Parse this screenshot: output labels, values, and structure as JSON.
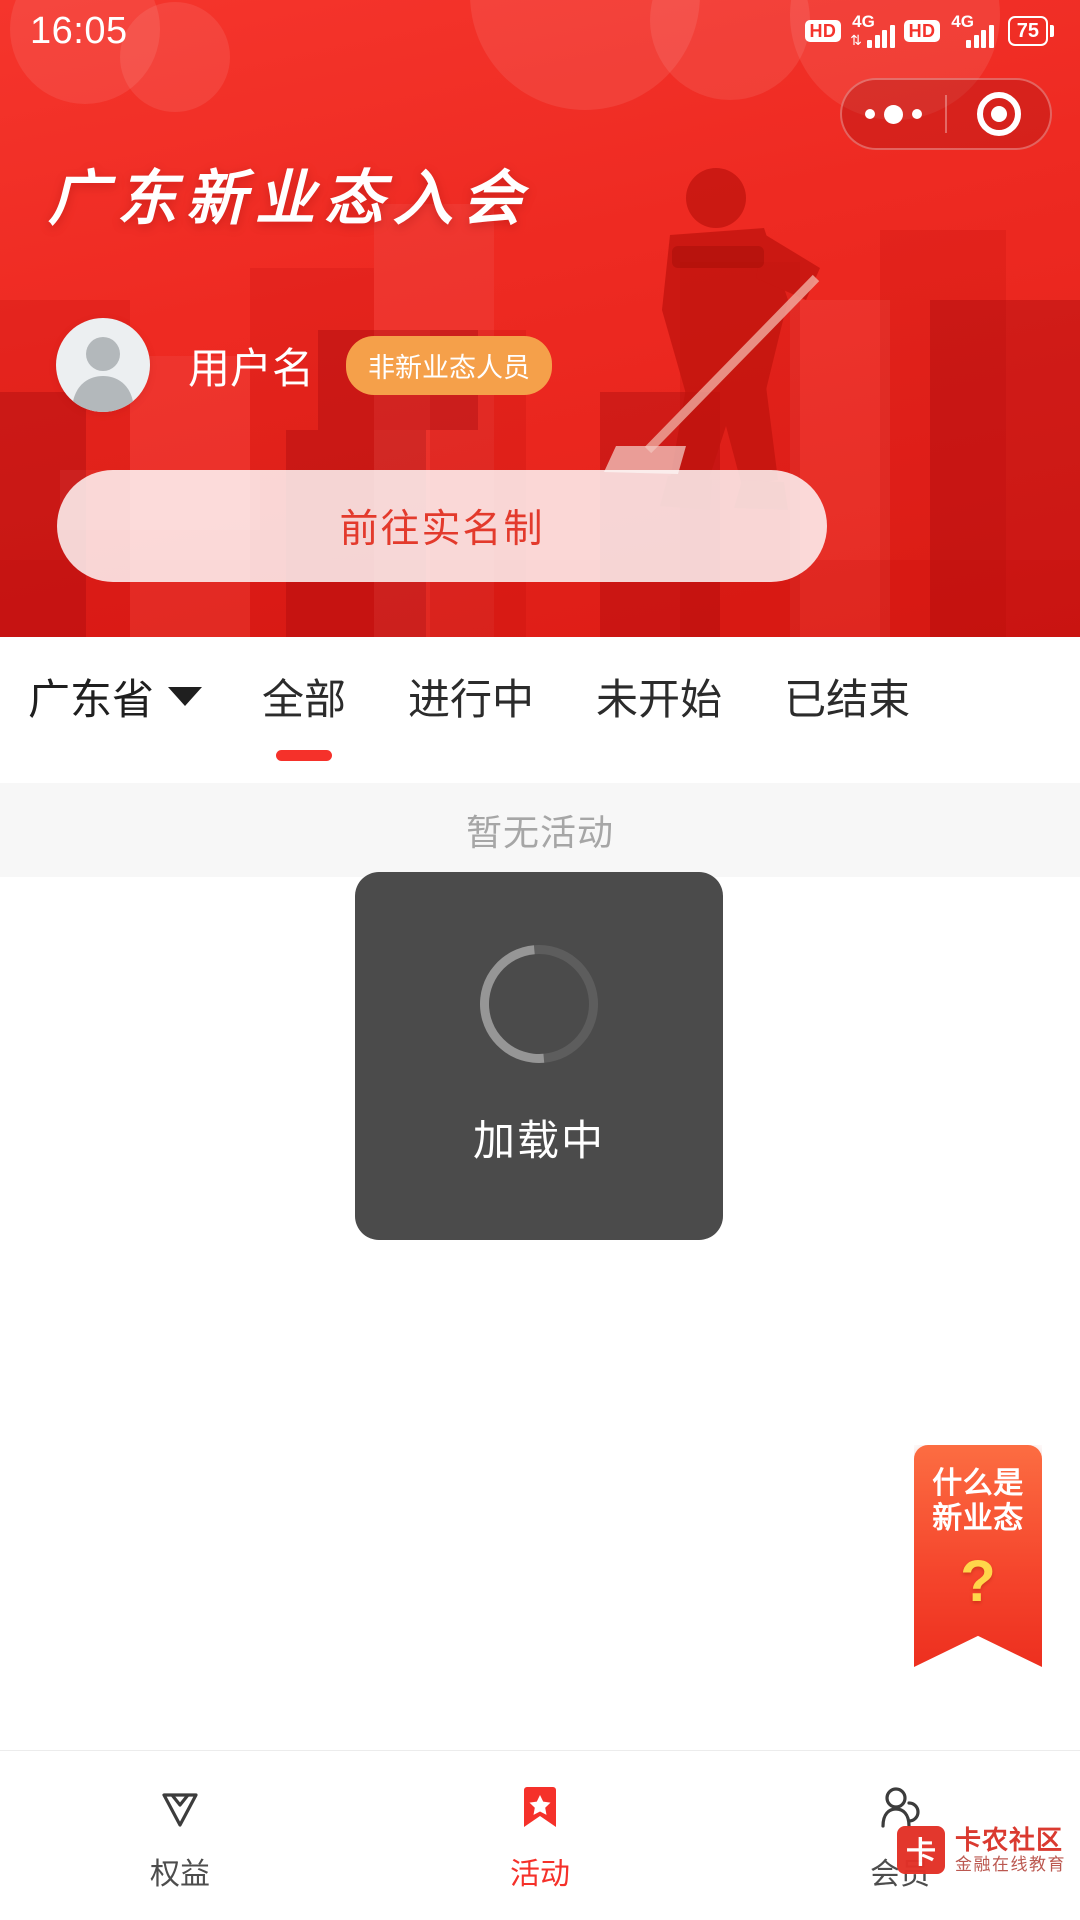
{
  "statusbar": {
    "time": "16:05",
    "hd1": "HD",
    "net1": "4G",
    "hd2": "HD",
    "net2": "4G",
    "battery": "75"
  },
  "capsule": {
    "more_icon": "more-dots-icon",
    "target_icon": "target-circle-icon"
  },
  "hero": {
    "title": "广东新业态入会",
    "avatar_icon": "person-avatar-icon",
    "user_name": "用户名",
    "user_badge": "非新业态人员",
    "cta_label": "前往实名制",
    "bg_color": "#ef2a22"
  },
  "filterbar": {
    "region": "广东省",
    "caret_icon": "chevron-down-icon",
    "tabs": [
      {
        "label": "全部",
        "active": true
      },
      {
        "label": "进行中",
        "active": false
      },
      {
        "label": "未开始",
        "active": false
      },
      {
        "label": "已结束",
        "active": false
      }
    ],
    "accent": "#f5312a"
  },
  "content": {
    "empty_text": "暂无活动"
  },
  "toast": {
    "spinner_icon": "loading-spinner-icon",
    "label": "加载中"
  },
  "float_badge": {
    "line1": "什么是",
    "line2": "新业态",
    "question_mark": "?",
    "color": "#f5452c"
  },
  "bottomnav": {
    "items": [
      {
        "label": "权益",
        "icon": "diamond-icon",
        "active": false
      },
      {
        "label": "活动",
        "icon": "bookmark-star-icon",
        "active": true
      },
      {
        "label": "会员",
        "icon": "member-person-icon",
        "active": false
      }
    ],
    "active_color": "#f5312a"
  },
  "watermark": {
    "mark": "卡",
    "title": "卡农社区",
    "subtitle": "金融在线教育"
  }
}
